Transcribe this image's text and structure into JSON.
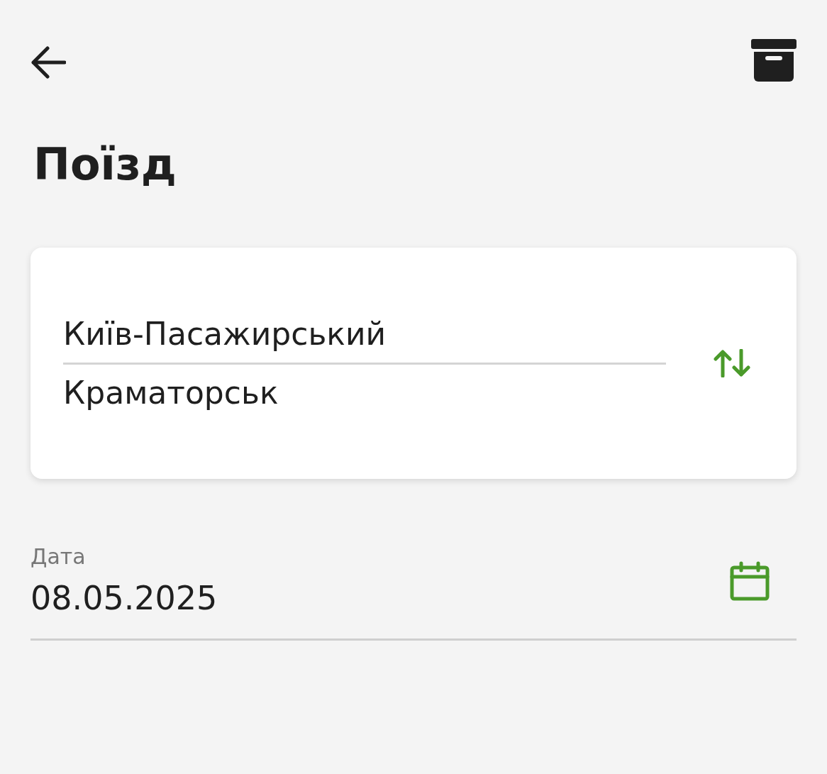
{
  "title": "Поїзд",
  "route": {
    "from": "Київ-Пасажирський",
    "to": "Краматорськ"
  },
  "date": {
    "label": "Дата",
    "value": "08.05.2025"
  }
}
